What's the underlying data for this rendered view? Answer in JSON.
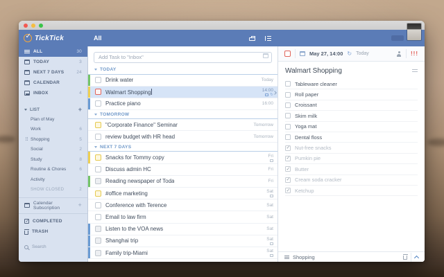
{
  "appbar": {
    "brand": "TickTick",
    "view_title": "All"
  },
  "sidebar": {
    "top_items": [
      {
        "label": "ALL",
        "count": "30",
        "icon": "all-lists-icon",
        "selected": true
      },
      {
        "label": "TODAY",
        "count": "3",
        "icon": "calendar-icon",
        "selected": false
      },
      {
        "label": "NEXT 7 DAYS",
        "count": "24",
        "icon": "calendar-icon",
        "selected": false
      },
      {
        "label": "CALENDAR",
        "count": "",
        "icon": "calendar-icon",
        "selected": false
      },
      {
        "label": "INBOX",
        "count": "4",
        "icon": "inbox-icon",
        "selected": false
      }
    ],
    "list_header": {
      "label": "LIST",
      "add": "+"
    },
    "lists": [
      {
        "label": "Plan of May",
        "count": ""
      },
      {
        "label": "Work",
        "count": "6"
      },
      {
        "label": "Shopping",
        "count": "5"
      },
      {
        "label": "Social",
        "count": "2"
      },
      {
        "label": "Study",
        "count": "8"
      },
      {
        "label": "Routine & Chores",
        "count": "6"
      },
      {
        "label": "Activity",
        "count": ""
      },
      {
        "label": "SHOW CLOSED",
        "count": "2"
      }
    ],
    "calendar_subscription": {
      "label": "Calendar Subscription",
      "add": "+"
    },
    "completed_label": "COMPLETED",
    "trash_label": "TRASH",
    "search": {
      "placeholder": "Search"
    }
  },
  "tasks_panel": {
    "add_task_placeholder": "Add Task to \"Inbox\"",
    "sections": [
      {
        "label": "TODAY",
        "tasks": [
          {
            "title": "Drink water",
            "meta": "Today",
            "bar": "green",
            "checkbox": "plain"
          },
          {
            "title": "Walmart Shopping",
            "meta": "14:00",
            "bar": "yellow",
            "checkbox": "red",
            "selected": true
          },
          {
            "title": "Practice piano",
            "meta": "16:00",
            "bar": "blue",
            "checkbox": "plain"
          }
        ]
      },
      {
        "label": "TOMORROW",
        "tasks": [
          {
            "title": "\"Corporate Finance\" Seminar",
            "meta": "Tomorrow",
            "bar": "",
            "checkbox": "yellow"
          },
          {
            "title": "review budget with HR head",
            "meta": "Tomorrow",
            "bar": "",
            "checkbox": "plain"
          }
        ]
      },
      {
        "label": "NEXT 7 DAYS",
        "tasks": [
          {
            "title": "Snacks for Tommy copy",
            "meta": "Fri",
            "bar": "yellow",
            "checkbox": "yellow",
            "has_icons": true
          },
          {
            "title": "Discuss admin HC",
            "meta": "Fri",
            "bar": "",
            "checkbox": "plain"
          },
          {
            "title": "Reading newspaper of Toda",
            "meta": "Fri",
            "bar": "green",
            "checkbox": "gray"
          },
          {
            "title": "#office marketing",
            "meta": "Sat",
            "bar": "",
            "checkbox": "yellow",
            "has_icons": true
          },
          {
            "title": "Conference with Terence",
            "meta": "Sat",
            "bar": "",
            "checkbox": "plain"
          },
          {
            "title": "Email to law firm",
            "meta": "Sat",
            "bar": "",
            "checkbox": "plain"
          },
          {
            "title": "Listen to the VOA news",
            "meta": "Sat",
            "bar": "blue",
            "checkbox": "gray"
          },
          {
            "title": "Shanghai trip",
            "meta": "Sat",
            "bar": "blue",
            "checkbox": "gray",
            "has_icons": true
          },
          {
            "title": "Family trip-Miami",
            "meta": "Sat",
            "bar": "blue",
            "checkbox": "gray",
            "has_icons": true
          }
        ]
      }
    ]
  },
  "detail_panel": {
    "toolbar": {
      "date": "May 27, 14:00",
      "today": "Today",
      "priority": "!!!"
    },
    "title": "Walmart Shopping",
    "checklist": [
      {
        "label": "Tableware cleaner",
        "checked": false
      },
      {
        "label": "Roll paper",
        "checked": false
      },
      {
        "label": "Croissant",
        "checked": false
      },
      {
        "label": "Skim milk",
        "checked": false
      },
      {
        "label": "Yoga mat",
        "checked": false
      },
      {
        "label": "Dental floss",
        "checked": false
      },
      {
        "label": "Nut-free snacks",
        "checked": true
      },
      {
        "label": "Pumkin pie",
        "checked": true
      },
      {
        "label": "Butter",
        "checked": true
      },
      {
        "label": "Cream soda cracker",
        "checked": true
      },
      {
        "label": "Ketchup",
        "checked": true
      }
    ],
    "footer": {
      "list_name": "Shopping"
    }
  },
  "colors": {
    "appbar_blue": "#5b7cb7",
    "sidebar_bg": "#d9e2f0",
    "selected_row_bg": "#d6e4f7",
    "priority_red": "#e0524a",
    "bar_green": "#74c468",
    "bar_yellow": "#efd052",
    "bar_blue": "#6a9bd3"
  }
}
